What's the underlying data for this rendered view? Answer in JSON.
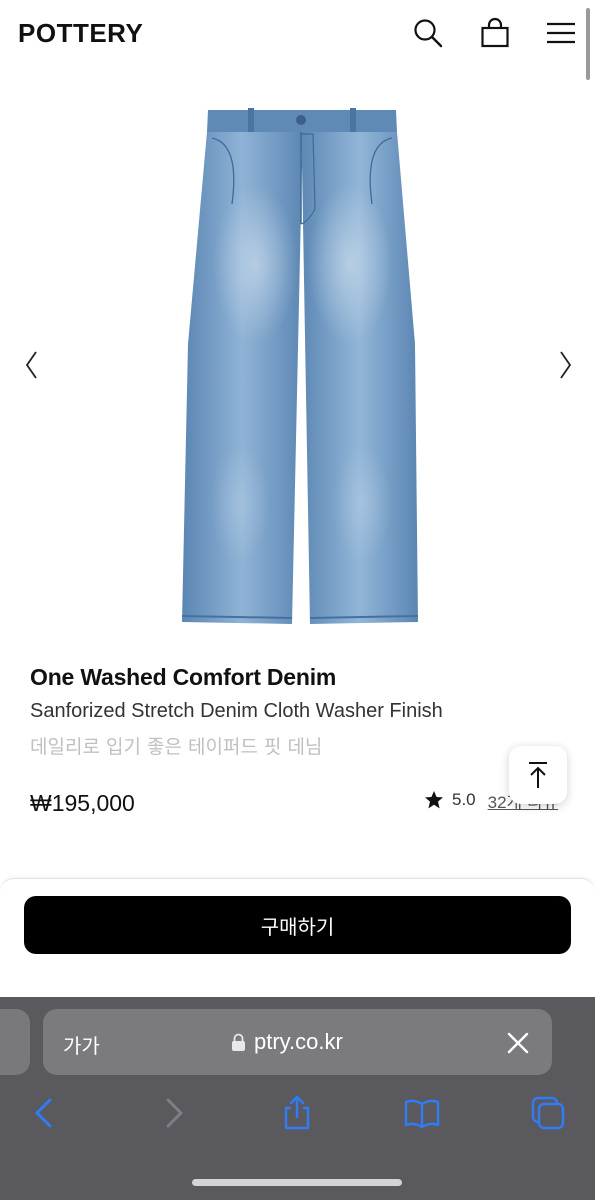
{
  "header": {
    "brand": "POTTERY",
    "icons": [
      "search-icon",
      "shopping-bag-icon",
      "hamburger-menu-icon"
    ]
  },
  "gallery": {
    "image": "light-wash-denim-jeans",
    "prev_icon": "chevron-left-icon",
    "next_icon": "chevron-right-icon"
  },
  "product": {
    "title": "One Washed Comfort Denim",
    "subtitle": "Sanforized Stretch Denim Cloth Washer Finish",
    "description": "데일리로 입기 좋은 테이퍼드 핏 데님",
    "price": "₩195,000",
    "rating": "5.0",
    "review_link": "32개 리뷰"
  },
  "scroll_top_icon": "arrow-up-to-top-icon",
  "buy_button": {
    "label": "구매하기"
  },
  "browser": {
    "text_size_label": "가가",
    "url": "ptry.co.kr",
    "toolbar_icons": [
      "back-icon",
      "forward-icon",
      "share-icon",
      "bookmarks-icon",
      "tabs-icon"
    ]
  },
  "colors": {
    "button_bg": "#000000",
    "safari_bg": "#5a5a5e",
    "safari_accent": "#2f7cf6",
    "denim": "#6f9bc6"
  }
}
